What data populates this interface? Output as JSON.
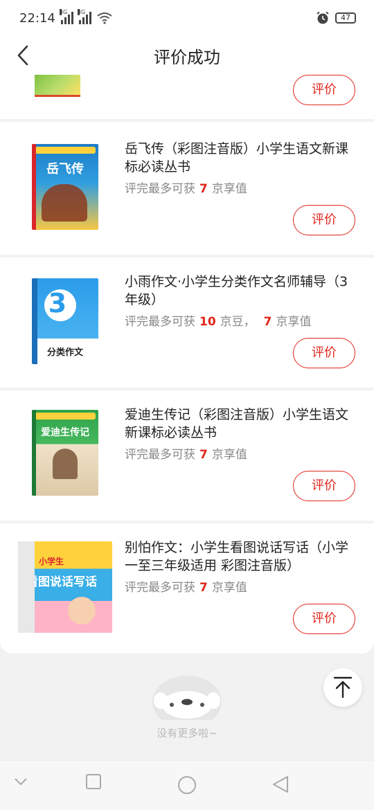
{
  "status_bar": {
    "time": "22:14",
    "network_1": "4G",
    "network_2": "4G",
    "battery": "47"
  },
  "header": {
    "title": "评价成功"
  },
  "items": [
    {
      "title": "",
      "reward_prefix": "",
      "rate_label": "评价"
    },
    {
      "title": "岳飞传（彩图注音版）小学生语文新课标必读丛书",
      "reward_prefix": "评完最多可获",
      "reward_parts": [
        {
          "num": "7",
          "unit": "京享值"
        }
      ],
      "cover_title": "岳飞传",
      "rate_label": "评价"
    },
    {
      "title": "小雨作文·小学生分类作文名师辅导（3年级）",
      "reward_prefix": "评完最多可获",
      "reward_parts": [
        {
          "num": "10",
          "unit": "京豆，"
        },
        {
          "num": "7",
          "unit": "京享值"
        }
      ],
      "cover_title": "分类作文",
      "cover_big": "3",
      "rate_label": "评价"
    },
    {
      "title": "爱迪生传记（彩图注音版）小学生语文新课标必读丛书",
      "reward_prefix": "评完最多可获",
      "reward_parts": [
        {
          "num": "7",
          "unit": "京享值"
        }
      ],
      "cover_title": "爱迪生传记",
      "rate_label": "评价"
    },
    {
      "title": "别怕作文：小学生看图说话写话（小学一至三年级适用 彩图注音版）",
      "reward_prefix": "评完最多可获",
      "reward_parts": [
        {
          "num": "7",
          "unit": "京享值"
        }
      ],
      "cover_title": "看图说话写话",
      "cover_small": "小学生",
      "rate_label": "评价"
    }
  ],
  "footer": {
    "no_more": "没有更多啦~"
  },
  "colors": {
    "accent": "#e1251b",
    "background": "#f2f2f2"
  }
}
